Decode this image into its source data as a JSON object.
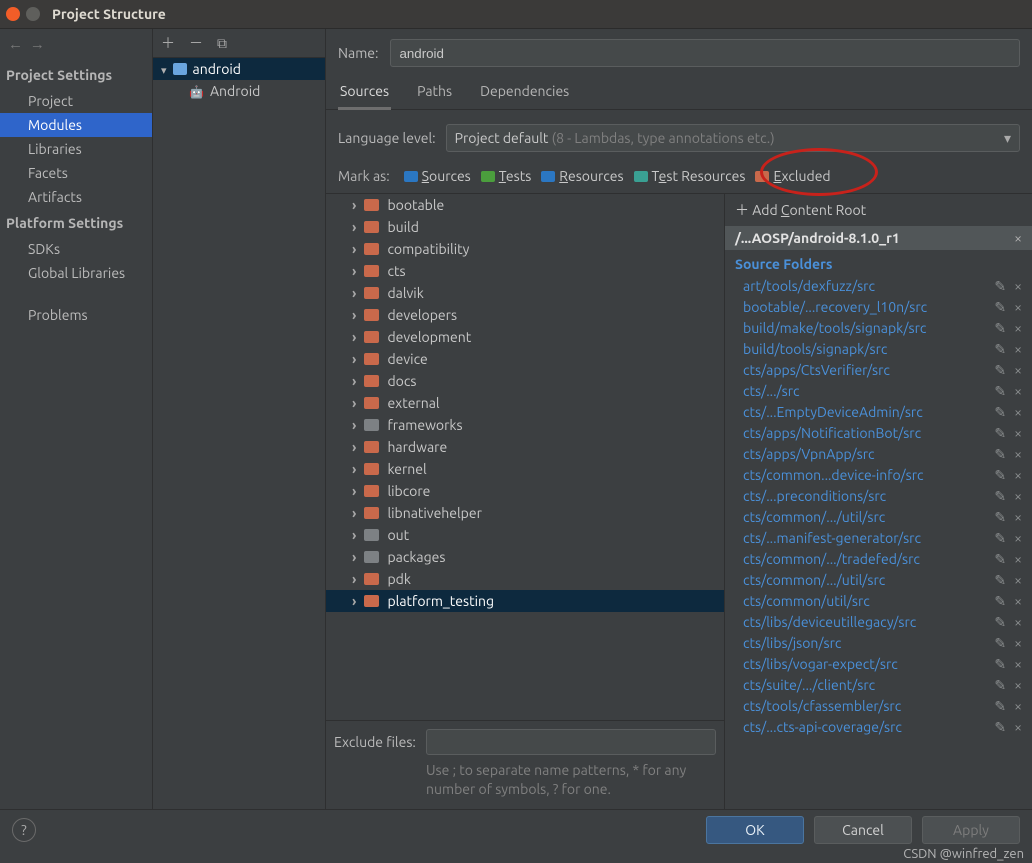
{
  "window": {
    "title": "Project Structure"
  },
  "sidebar": {
    "sections": [
      {
        "title": "Project Settings",
        "items": [
          "Project",
          "Modules",
          "Libraries",
          "Facets",
          "Artifacts"
        ],
        "selected": 1
      },
      {
        "title": "Platform Settings",
        "items": [
          "SDKs",
          "Global Libraries"
        ]
      },
      {
        "title": "",
        "items": [
          "Problems"
        ]
      }
    ]
  },
  "moduleTree": {
    "root": "android",
    "child": "Android"
  },
  "form": {
    "nameLabel": "Name:",
    "nameValue": "android",
    "tabs": [
      "Sources",
      "Paths",
      "Dependencies"
    ],
    "activeTab": 0,
    "langLabel": "Language level:",
    "langValue": "Project default",
    "langHint": " (8 - Lambdas, type annotations etc.)",
    "markLabel": "Mark as:",
    "marks": [
      {
        "label": "Sources",
        "ukey": "S",
        "color": "mi-blue"
      },
      {
        "label": "Tests",
        "ukey": "T",
        "color": "mi-green"
      },
      {
        "label": "Resources",
        "ukey": "R",
        "color": "mi-dk"
      },
      {
        "label": "Test Resources",
        "ukey": "e",
        "color": "mi-teal"
      },
      {
        "label": "Excluded",
        "ukey": "E",
        "color": "mi-orange"
      }
    ]
  },
  "dirs": [
    {
      "name": "bootable",
      "color": "orange"
    },
    {
      "name": "build",
      "color": "orange"
    },
    {
      "name": "compatibility",
      "color": "orange"
    },
    {
      "name": "cts",
      "color": "orange"
    },
    {
      "name": "dalvik",
      "color": "orange"
    },
    {
      "name": "developers",
      "color": "orange"
    },
    {
      "name": "development",
      "color": "orange"
    },
    {
      "name": "device",
      "color": "orange"
    },
    {
      "name": "docs",
      "color": "orange"
    },
    {
      "name": "external",
      "color": "orange"
    },
    {
      "name": "frameworks",
      "color": "gray"
    },
    {
      "name": "hardware",
      "color": "orange"
    },
    {
      "name": "kernel",
      "color": "orange"
    },
    {
      "name": "libcore",
      "color": "orange"
    },
    {
      "name": "libnativehelper",
      "color": "orange"
    },
    {
      "name": "out",
      "color": "gray"
    },
    {
      "name": "packages",
      "color": "gray"
    },
    {
      "name": "pdk",
      "color": "orange"
    },
    {
      "name": "platform_testing",
      "color": "orange",
      "selected": true
    }
  ],
  "exclude": {
    "label": "Exclude files:",
    "value": "",
    "hint1": "Use ; to separate name patterns, * for any",
    "hint2": "number of symbols, ? for one."
  },
  "roots": {
    "addLabel": "Add Content Root",
    "addKey": "C",
    "path": "/...AOSP/android-8.1.0_r1",
    "groupTitle": "Source Folders",
    "items": [
      "art/tools/dexfuzz/src",
      "bootable/...recovery_l10n/src",
      "build/make/tools/signapk/src",
      "build/tools/signapk/src",
      "cts/apps/CtsVerifier/src",
      "cts/.../src",
      "cts/...EmptyDeviceAdmin/src",
      "cts/apps/NotificationBot/src",
      "cts/apps/VpnApp/src",
      "cts/common...device-info/src",
      "cts/...preconditions/src",
      "cts/common/.../util/src",
      "cts/...manifest-generator/src",
      "cts/common/.../tradefed/src",
      "cts/common/.../util/src",
      "cts/common/util/src",
      "cts/libs/deviceutillegacy/src",
      "cts/libs/json/src",
      "cts/libs/vogar-expect/src",
      "cts/suite/.../client/src",
      "cts/tools/cfassembler/src",
      "cts/...cts-api-coverage/src"
    ]
  },
  "footer": {
    "ok": "OK",
    "cancel": "Cancel",
    "apply": "Apply"
  },
  "watermark": "CSDN @winfred_zen"
}
